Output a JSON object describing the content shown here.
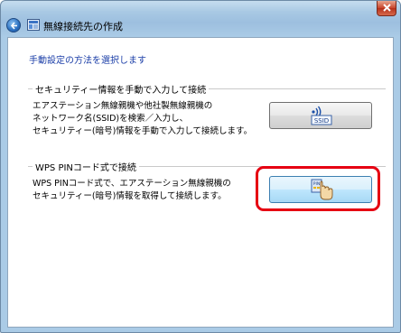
{
  "window": {
    "title": "無線接続先の作成"
  },
  "icons": {
    "back": "back-arrow-icon",
    "close": "close-icon",
    "app": "wireless-setup-icon",
    "manual": "wireless-ssid-icon",
    "wps": "wps-pin-hand-icon"
  },
  "content": {
    "instruction": "手動設定の方法を選択します"
  },
  "manual_group": {
    "title": "セキュリティー情報を手動で入力して接続",
    "desc_line1": "エアステーション無線親機や他社製無線親機の",
    "desc_line2": "ネットワーク名(SSID)を検索／入力し、",
    "desc_line3": "セキュリティー(暗号)情報を手動で入力して接続します。",
    "icon_label": "SSID"
  },
  "wps_group": {
    "title": "WPS PINコード式で接続",
    "desc_line1": "WPS PINコード式で、エアステーション無線親機の",
    "desc_line2": "セキュリティー(暗号)情報を取得して接続します。",
    "icon_label": "PIN"
  },
  "colors": {
    "instruction_text": "#1c3fa8",
    "highlight": "#e60012"
  }
}
